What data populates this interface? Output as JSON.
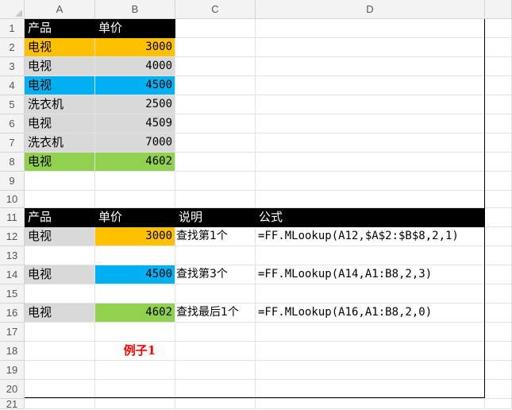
{
  "columns": [
    "A",
    "B",
    "C",
    "D"
  ],
  "rows": [
    "1",
    "2",
    "3",
    "4",
    "5",
    "6",
    "7",
    "8",
    "9",
    "10",
    "11",
    "12",
    "13",
    "14",
    "15",
    "16",
    "17",
    "18",
    "19",
    "20",
    "21"
  ],
  "table1": {
    "headers": [
      "产品",
      "单价"
    ],
    "rows": [
      {
        "product": "电视",
        "price": "3000",
        "color": "#ffc000"
      },
      {
        "product": "电视",
        "price": "4000",
        "color": "#d9d9d9"
      },
      {
        "product": "电视",
        "price": "4500",
        "color": "#00b0f0"
      },
      {
        "product": "洗衣机",
        "price": "2500",
        "color": "#d9d9d9"
      },
      {
        "product": "电视",
        "price": "4509",
        "color": "#d9d9d9"
      },
      {
        "product": "洗衣机",
        "price": "7000",
        "color": "#d9d9d9"
      },
      {
        "product": "电视",
        "price": "4602",
        "color": "#92d050"
      }
    ]
  },
  "table2": {
    "headers": [
      "产品",
      "单价",
      "说明",
      "公式"
    ],
    "rows": [
      {
        "product": "电视",
        "price": "3000",
        "note": "查找第1个",
        "formula": "=FF.MLookup(A12,$A$2:$B$8,2,1)",
        "color": "#ffc000"
      },
      {
        "product": "电视",
        "price": "4500",
        "note": "查找第3个",
        "formula": "=FF.MLookup(A14,A1:B8,2,3)",
        "color": "#00b0f0"
      },
      {
        "product": "电视",
        "price": "4602",
        "note": "查找最后1个",
        "formula": "=FF.MLookup(A16,A1:B8,2,0)",
        "color": "#92d050"
      }
    ]
  },
  "example_label": "例子1"
}
